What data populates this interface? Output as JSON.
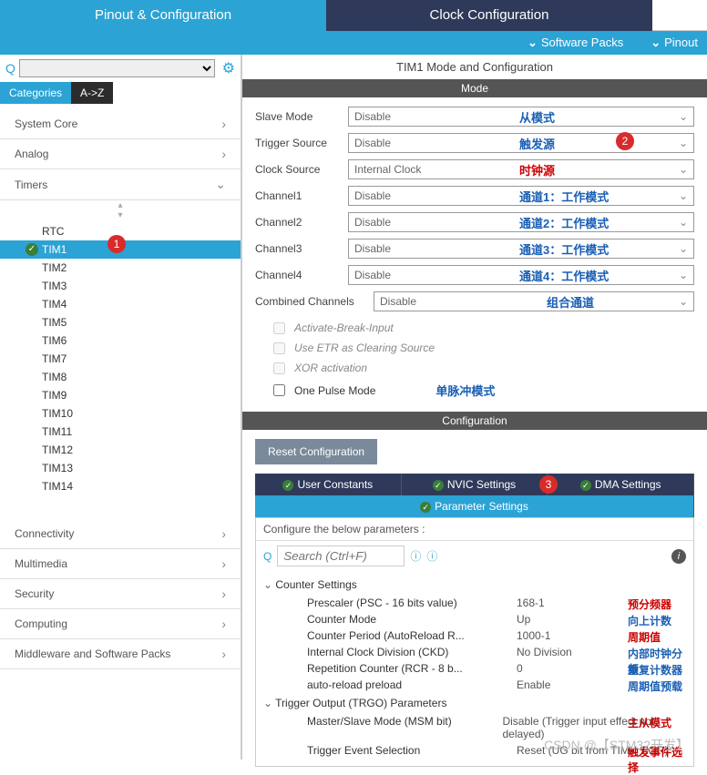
{
  "top_tabs": {
    "pinout": "Pinout & Configuration",
    "clock": "Clock Configuration"
  },
  "sub_bar": {
    "software_packs": "Software Packs",
    "pinout": "Pinout"
  },
  "left": {
    "tabs": {
      "categories": "Categories",
      "az": "A->Z"
    },
    "sections": {
      "system_core": "System Core",
      "analog": "Analog",
      "timers": "Timers",
      "connectivity": "Connectivity",
      "multimedia": "Multimedia",
      "security": "Security",
      "computing": "Computing",
      "middleware": "Middleware and Software Packs"
    },
    "timer_items": [
      "RTC",
      "TIM1",
      "TIM2",
      "TIM3",
      "TIM4",
      "TIM5",
      "TIM6",
      "TIM7",
      "TIM8",
      "TIM9",
      "TIM10",
      "TIM11",
      "TIM12",
      "TIM13",
      "TIM14"
    ],
    "badge1": "1"
  },
  "right": {
    "title": "TIM1 Mode and Configuration",
    "mode_header": "Mode",
    "config_header": "Configuration",
    "badge2": "2",
    "badge3": "3",
    "mode": {
      "slave": {
        "label": "Slave Mode",
        "value": "Disable",
        "ann": "从模式"
      },
      "trigger": {
        "label": "Trigger Source",
        "value": "Disable",
        "ann": "触发源"
      },
      "clock": {
        "label": "Clock Source",
        "value": "Internal Clock",
        "ann": "时钟源"
      },
      "ch1": {
        "label": "Channel1",
        "value": "Disable",
        "ann": "通道1：工作模式"
      },
      "ch2": {
        "label": "Channel2",
        "value": "Disable",
        "ann": "通道2：工作模式"
      },
      "ch3": {
        "label": "Channel3",
        "value": "Disable",
        "ann": "通道3：工作模式"
      },
      "ch4": {
        "label": "Channel4",
        "value": "Disable",
        "ann": "通道4：工作模式"
      },
      "combined_label": "Combined Channels",
      "combined_value": "Disable",
      "combined_ann": "组合通道",
      "brk": "Activate-Break-Input",
      "etr": "Use ETR as Clearing Source",
      "xor": "XOR activation",
      "one_pulse": "One Pulse Mode",
      "one_pulse_ann": "单脉冲模式"
    },
    "config": {
      "reset": "Reset Configuration",
      "tabs": {
        "user": "User Constants",
        "nvic": "NVIC Settings",
        "dma": "DMA Settings",
        "param": "Parameter Settings"
      },
      "param_title": "Configure the below parameters :",
      "search_ph": "Search (Ctrl+F)",
      "groups": {
        "counter": "Counter Settings",
        "trgo": "Trigger Output (TRGO) Parameters"
      },
      "params": {
        "psc": {
          "name": "Prescaler (PSC - 16 bits value)",
          "val": "168-1",
          "ann": "预分频器"
        },
        "mode": {
          "name": "Counter Mode",
          "val": "Up",
          "ann": "向上计数"
        },
        "period": {
          "name": "Counter Period (AutoReload R...",
          "val": "1000-1",
          "ann": "周期值"
        },
        "ckd": {
          "name": "Internal Clock Division (CKD)",
          "val": "No Division",
          "ann": "内部时钟分频"
        },
        "rcr": {
          "name": "Repetition Counter (RCR - 8 b...",
          "val": "0",
          "ann": "重复计数器"
        },
        "preload": {
          "name": "auto-reload preload",
          "val": "Enable",
          "ann": "周期值预载"
        },
        "msm": {
          "name": "Master/Slave Mode (MSM bit)",
          "val": "Disable (Trigger input effect not delayed)",
          "ann": "主从模式"
        },
        "tes": {
          "name": "Trigger Event Selection",
          "val": "Reset (UG bit from TIMx_EGR)",
          "ann": "触发事件选择"
        }
      }
    }
  },
  "watermark": "CSDN @【STM32开发】"
}
